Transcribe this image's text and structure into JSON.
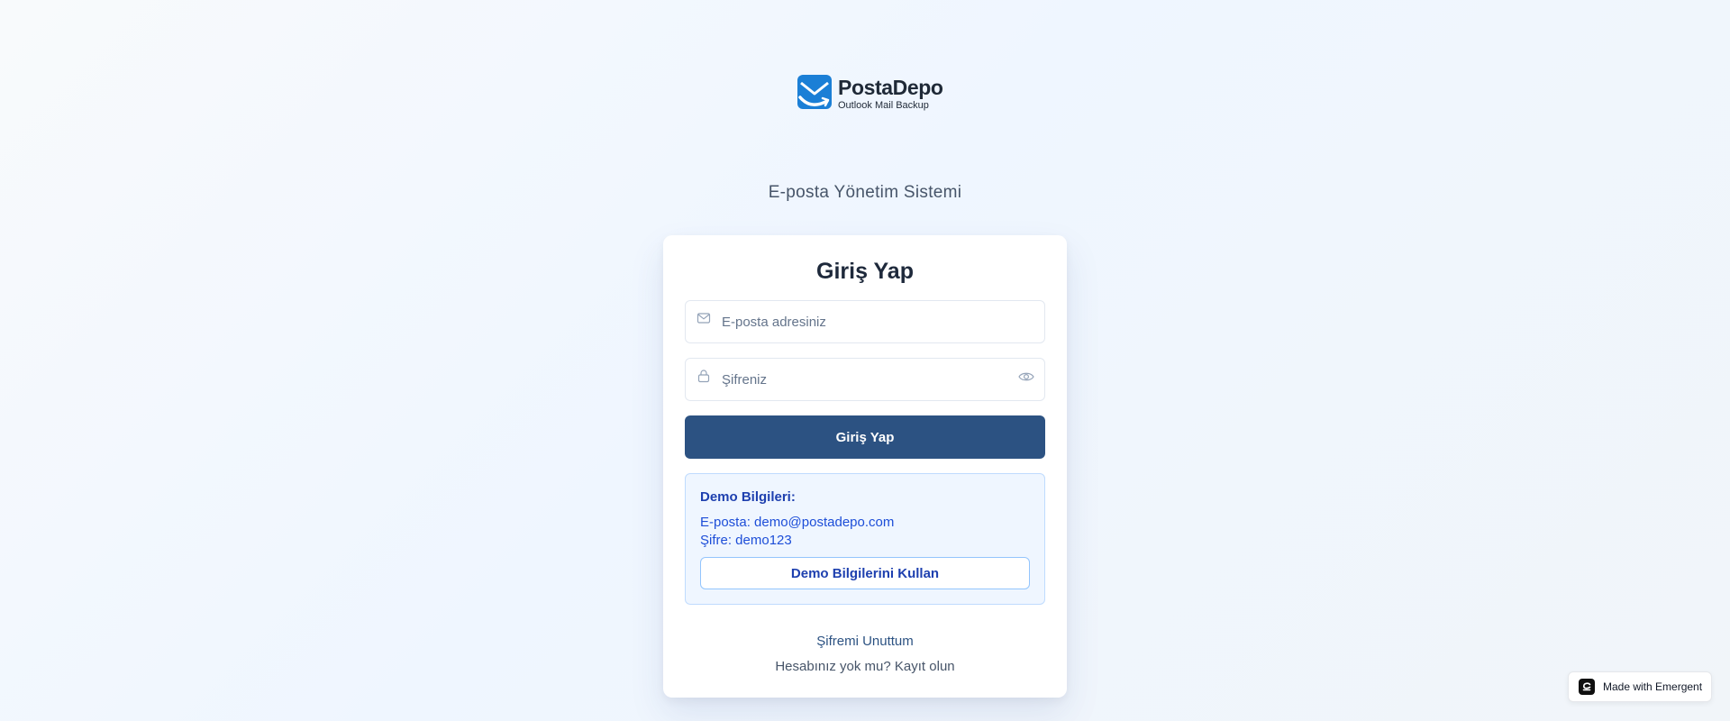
{
  "brand": {
    "name": "PostaDepo",
    "tagline": "Outlook Mail Backup",
    "color": "#1b7fd6"
  },
  "app_subtitle": "E-posta Yönetim Sistemi",
  "login": {
    "title": "Giriş Yap",
    "email": {
      "placeholder": "E-posta adresiniz",
      "value": "",
      "icon": "mail-icon"
    },
    "password": {
      "placeholder": "Şifreniz",
      "value": "",
      "icon": "lock-icon",
      "toggle_icon": "eye-icon"
    },
    "submit_label": "Giriş Yap",
    "submit_color": "#2c5282"
  },
  "demo": {
    "title": "Demo Bilgileri:",
    "email_line": "E-posta: demo@postadepo.com",
    "password_line": "Şifre: demo123",
    "button_label": "Demo Bilgilerini Kullan"
  },
  "footer_links": {
    "forgot_password": "Şifremi Unuttum",
    "register_prompt": "Hesabınız yok mu?",
    "register_link": "Kayıt olun"
  },
  "badge": {
    "label": "Made with Emergent",
    "icon": "emergent-logo-icon"
  }
}
